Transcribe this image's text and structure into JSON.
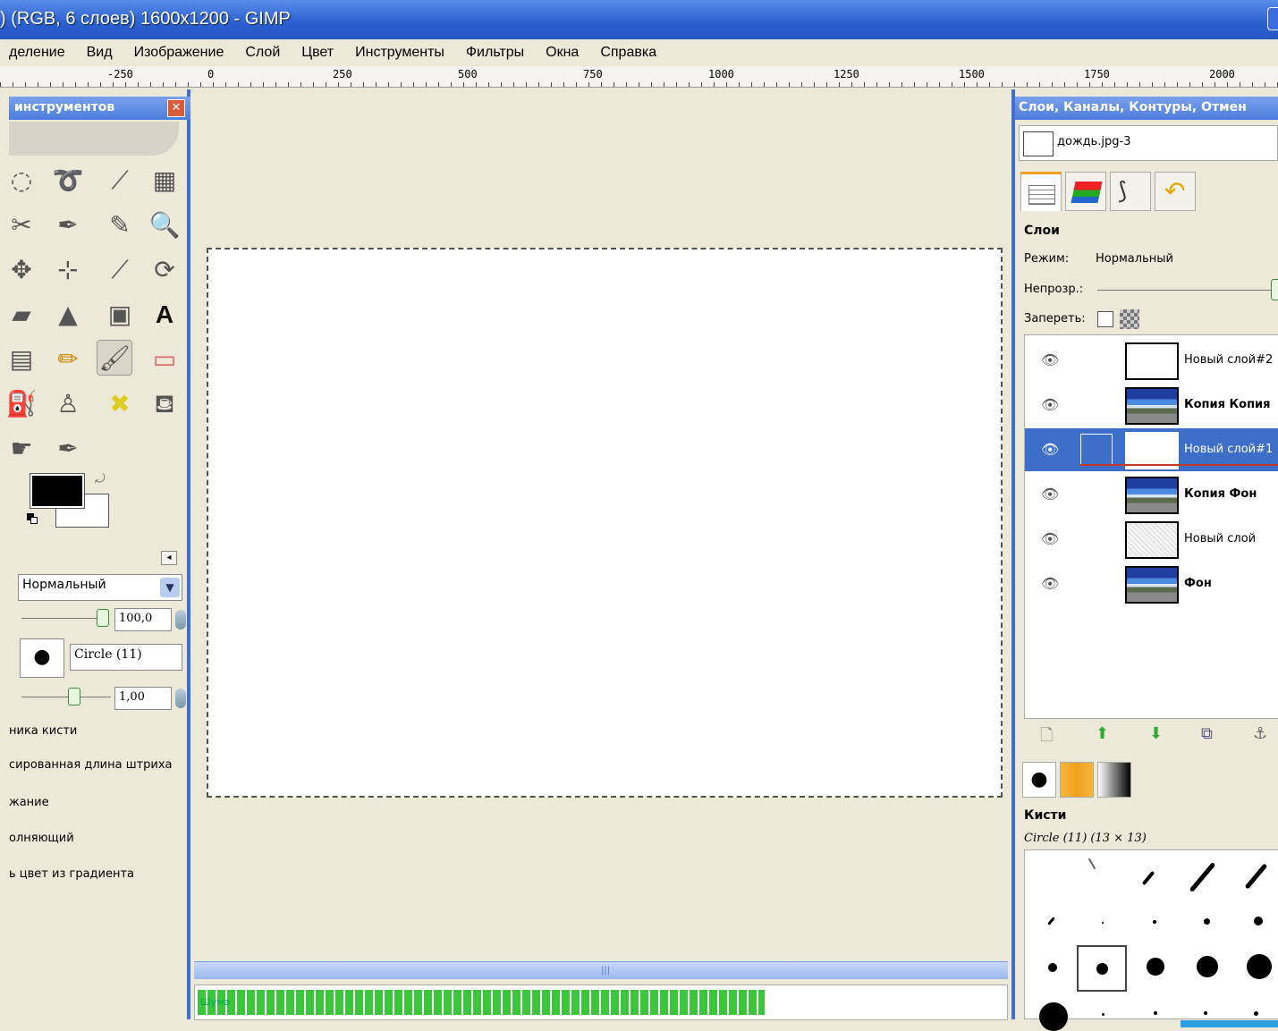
{
  "window": {
    "title": ") (RGB, 6 слоев) 1600x1200 - GIMP"
  },
  "menu": {
    "items": [
      "деление",
      "Вид",
      "Изображение",
      "Слой",
      "Цвет",
      "Инструменты",
      "Фильтры",
      "Окна",
      "Справка"
    ]
  },
  "ruler": {
    "labels": [
      "-250",
      "0",
      "250",
      "500",
      "750",
      "1000",
      "1250",
      "1500",
      "1750",
      "2000"
    ]
  },
  "toolbox": {
    "title": "инструментов",
    "close_label": "✕",
    "tools": [
      "ellipse-select",
      "free-select",
      "fuzzy-select",
      "by-color-select",
      "scissors-select",
      "paths",
      "color-picker",
      "zoom",
      "move",
      "align",
      "crop",
      "rotate",
      "perspective",
      "flip",
      "cage-transform",
      "text",
      "blend",
      "pencil",
      "paintbrush",
      "eraser",
      "airbrush",
      "clone",
      "heal",
      "dodge-burn",
      "smudge",
      "ink"
    ],
    "mode_value": "Нормальный",
    "opacity_value": "100,0",
    "brush_value": "Circle (11)",
    "scale_value": "1,00",
    "options": [
      "ника кисти",
      "сированная длина штриха",
      "жание",
      "олняющий",
      "ь цвет из градиента"
    ]
  },
  "canvas": {
    "progress_text": "Шума"
  },
  "dock": {
    "title": "Слои, Каналы, Контуры, Отмен",
    "image_name": "дождь.jpg-3",
    "layers_title": "Слои",
    "mode_label": "Режим:",
    "mode_value": "Нормальный",
    "opacity_label": "Непрозр.:",
    "lock_label": "Запереть:",
    "layers": [
      {
        "name": "Новый слой#2",
        "thumb": "white",
        "bold": false,
        "selected": false
      },
      {
        "name": "Копия Копия",
        "thumb": "photo",
        "bold": true,
        "selected": false
      },
      {
        "name": "Новый слой#1",
        "thumb": "white",
        "bold": false,
        "selected": true
      },
      {
        "name": "Копия Фон",
        "thumb": "photo",
        "bold": true,
        "selected": false
      },
      {
        "name": "Новый слой",
        "thumb": "noise",
        "bold": false,
        "selected": false
      },
      {
        "name": "Фон",
        "thumb": "photo",
        "bold": true,
        "selected": false
      }
    ],
    "brushes_title": "Кисти",
    "brush_name": "Circle (11) (13 × 13)"
  },
  "colors": {
    "titlebar": "#2a5fd0",
    "selection": "#3d6fc8",
    "progress": "#3cc63c"
  }
}
